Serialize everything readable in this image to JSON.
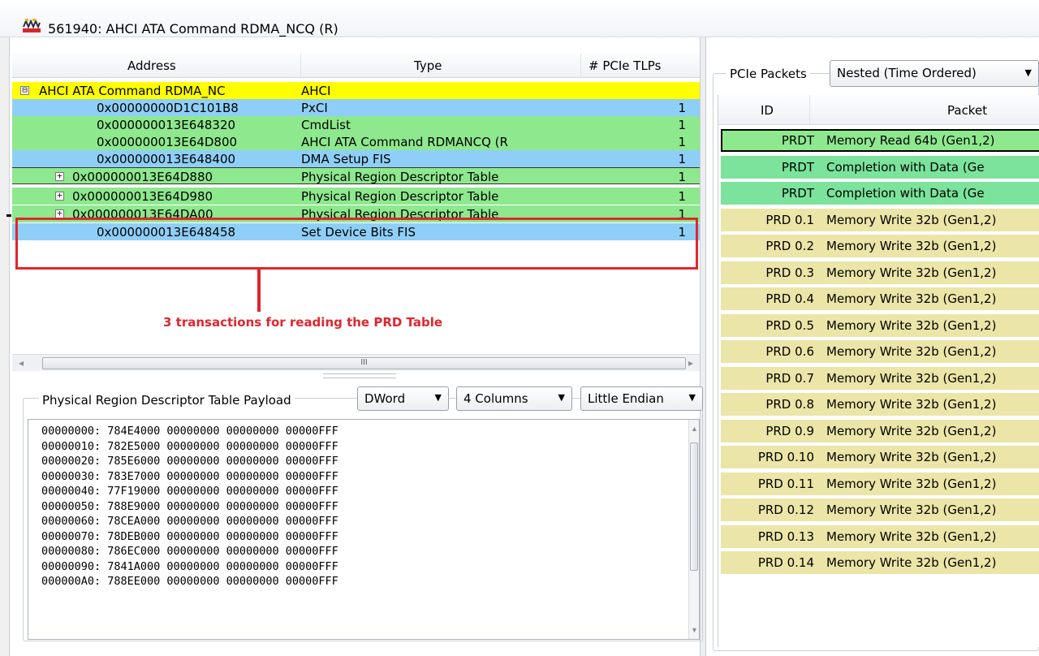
{
  "window": {
    "title": "561940: AHCI ATA Command RDMA_NCQ (R)",
    "icon": "pcie-analyzer-app-icon"
  },
  "tree": {
    "columns": {
      "address": "Address",
      "type": "Type",
      "tlps": "# PCIe TLPs"
    },
    "rows": [
      {
        "expander": "⊟",
        "address": "AHCI ATA Command RDMA_NC",
        "type": "AHCI",
        "tlps": "",
        "color": "#ffff00",
        "root": true
      },
      {
        "expander": "",
        "address": "0x00000000D1C101B8",
        "type": "PxCI",
        "tlps": "1",
        "color": "#8fcff7"
      },
      {
        "expander": "",
        "address": "0x000000013E648320",
        "type": "CmdList",
        "tlps": "1",
        "color": "#8ee88e"
      },
      {
        "expander": "",
        "address": "0x000000013E64D800",
        "type": "AHCI ATA Command RDMANCQ (R",
        "tlps": "1",
        "color": "#8ee88e"
      },
      {
        "expander": "",
        "address": "0x000000013E648400",
        "type": "DMA Setup FIS",
        "tlps": "1",
        "color": "#8fcff7"
      },
      {
        "expander": "+",
        "address": "0x000000013E64D880",
        "type": "Physical Region Descriptor Table",
        "tlps": "1",
        "color": "#8ee88e"
      },
      {
        "expander": "+",
        "address": "0x000000013E64D980",
        "type": "Physical Region Descriptor Table",
        "tlps": "1",
        "color": "#8ee88e"
      },
      {
        "expander": "+",
        "address": "0x000000013E64DA00",
        "type": "Physical Region Descriptor Table",
        "tlps": "1",
        "color": "#8ee88e"
      },
      {
        "expander": "",
        "address": "0x000000013E648458",
        "type": "Set Device Bits FIS",
        "tlps": "1",
        "color": "#8fcff7"
      }
    ],
    "annotation": "3 transactions for reading the PRD  Table",
    "scroll_thumb_glyph": "III"
  },
  "payload": {
    "label": "Physical Region Descriptor Table Payload",
    "format": "DWord",
    "columns": "4 Columns",
    "endian": "Little Endian",
    "lines": [
      "00000000: 784E4000 00000000 00000000 00000FFF",
      "00000010: 782E5000 00000000 00000000 00000FFF",
      "00000020: 785E6000 00000000 00000000 00000FFF",
      "00000030: 783E7000 00000000 00000000 00000FFF",
      "00000040: 77F19000 00000000 00000000 00000FFF",
      "00000050: 788E9000 00000000 00000000 00000FFF",
      "00000060: 78CEA000 00000000 00000000 00000FFF",
      "00000070: 78DEB000 00000000 00000000 00000FFF",
      "00000080: 786EC000 00000000 00000000 00000FFF",
      "00000090: 7841A000 00000000 00000000 00000FFF",
      "000000A0: 788EE000 00000000 00000000 00000FFF"
    ]
  },
  "packets": {
    "label": "PCIe Packets",
    "view_mode": "Nested (Time Ordered)",
    "columns": {
      "id": "ID",
      "packet": "Packet"
    },
    "rows": [
      {
        "id": "PRDT",
        "packet": "Memory Read 64b (Gen1,2)",
        "color": "#8ee88e",
        "selected": true
      },
      {
        "id": "PRDT",
        "packet": "Completion with Data (Ge",
        "color": "#7be39b"
      },
      {
        "id": "PRDT",
        "packet": "Completion with Data (Ge",
        "color": "#7be39b"
      },
      {
        "id": "PRD 0.1",
        "packet": "Memory Write 32b (Gen1,2)",
        "color": "#ebe5a8"
      },
      {
        "id": "PRD 0.2",
        "packet": "Memory Write 32b (Gen1,2)",
        "color": "#ebe5a8"
      },
      {
        "id": "PRD 0.3",
        "packet": "Memory Write 32b (Gen1,2)",
        "color": "#ebe5a8"
      },
      {
        "id": "PRD 0.4",
        "packet": "Memory Write 32b (Gen1,2)",
        "color": "#ebe5a8"
      },
      {
        "id": "PRD 0.5",
        "packet": "Memory Write 32b (Gen1,2)",
        "color": "#ebe5a8"
      },
      {
        "id": "PRD 0.6",
        "packet": "Memory Write 32b (Gen1,2)",
        "color": "#ebe5a8"
      },
      {
        "id": "PRD 0.7",
        "packet": "Memory Write 32b (Gen1,2)",
        "color": "#ebe5a8"
      },
      {
        "id": "PRD 0.8",
        "packet": "Memory Write 32b (Gen1,2)",
        "color": "#ebe5a8"
      },
      {
        "id": "PRD 0.9",
        "packet": "Memory Write 32b (Gen1,2)",
        "color": "#ebe5a8"
      },
      {
        "id": "PRD 0.10",
        "packet": "Memory Write 32b (Gen1,2)",
        "color": "#ebe5a8"
      },
      {
        "id": "PRD 0.11",
        "packet": "Memory Write 32b (Gen1,2)",
        "color": "#ebe5a8"
      },
      {
        "id": "PRD 0.12",
        "packet": "Memory Write 32b (Gen1,2)",
        "color": "#ebe5a8"
      },
      {
        "id": "PRD 0.13",
        "packet": "Memory Write 32b (Gen1,2)",
        "color": "#ebe5a8"
      },
      {
        "id": "PRD 0.14",
        "packet": "Memory Write 32b (Gen1,2)",
        "color": "#ebe5a8"
      }
    ]
  },
  "colors": {
    "annotation_red": "#e0262e",
    "root_yellow": "#ffff00",
    "fis_blue": "#8fcff7",
    "mem_green": "#8ee88e",
    "prd_tan": "#ebe5a8"
  }
}
